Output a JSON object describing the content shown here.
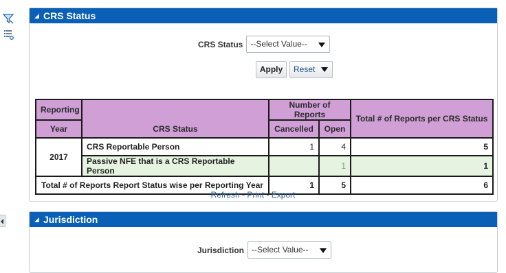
{
  "colors": {
    "header_bg": "#0a60b6",
    "table_header_bg": "#cf9fd6",
    "highlight_row_bg": "#e6f3e1"
  },
  "left_toolbar": {
    "icons": [
      "filter-icon",
      "list-settings-icon"
    ]
  },
  "crs_panel": {
    "title": "CRS Status",
    "filter": {
      "label": "CRS Status",
      "select_value": "--Select Value--"
    },
    "apply_label": "Apply",
    "reset_label": "Reset",
    "table": {
      "headers": {
        "reporting": "Reporting",
        "year": "Year",
        "crs_status": "CRS Status",
        "number_of_reports": "Number of Reports",
        "cancelled": "Cancelled",
        "open": "Open",
        "total_per_status": "Total # of Reports per CRS Status"
      },
      "year": "2017",
      "rows": [
        {
          "status": "CRS Reportable Person",
          "cancelled": "1",
          "open": "4",
          "total": "5"
        },
        {
          "status": "Passive NFE that is a CRS Reportable Person",
          "cancelled": "",
          "open": "1",
          "total": "1"
        }
      ],
      "total_row": {
        "label": "Total # of Reports Report Status wise per Reporting Year",
        "cancelled": "1",
        "open": "5",
        "total": "6"
      }
    },
    "links": {
      "refresh": "Refresh",
      "print": "Print",
      "export": "Export",
      "sep": " - "
    }
  },
  "jurisdiction_panel": {
    "title": "Jurisdiction",
    "filter": {
      "label": "Jurisdiction",
      "select_value": "--Select Value--"
    }
  }
}
